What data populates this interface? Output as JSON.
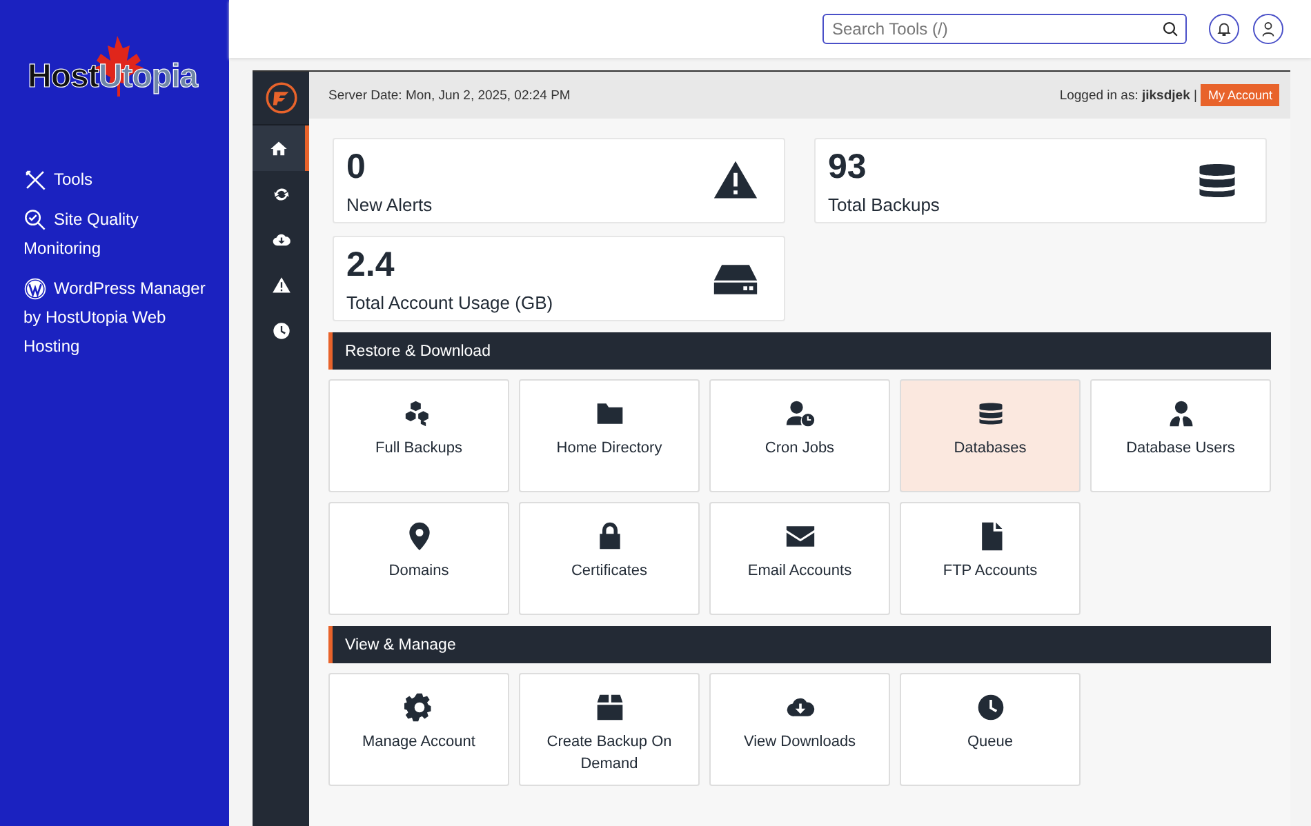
{
  "logo": {
    "dark": "Host",
    "light": "Utopia"
  },
  "sidebar": {
    "items": [
      {
        "label": "Tools"
      },
      {
        "label": "Site Quality Monitoring"
      },
      {
        "label": "WordPress Manager by HostUtopia Web Hosting"
      }
    ]
  },
  "search": {
    "placeholder": "Search Tools (/)"
  },
  "rail": [
    {
      "selected": true
    },
    {
      "selected": false
    },
    {
      "selected": false
    },
    {
      "selected": false
    },
    {
      "selected": false
    }
  ],
  "header": {
    "server_date": "Server Date: Mon, Jun 2, 2025, 02:24 PM",
    "logged_in_label": "Logged in as:",
    "user": "jiksdjek",
    "separator": "|",
    "account_button": "My Account"
  },
  "stats": [
    {
      "value": "0",
      "label": "New Alerts"
    },
    {
      "value": "93",
      "label": "Total Backups"
    },
    {
      "value": "2.4",
      "label": "Total Account Usage (GB)"
    }
  ],
  "sections": [
    {
      "title": "Restore & Download",
      "tiles": [
        {
          "label": "Full Backups",
          "selected": false
        },
        {
          "label": "Home Directory",
          "selected": false
        },
        {
          "label": "Cron Jobs",
          "selected": false
        },
        {
          "label": "Databases",
          "selected": true
        },
        {
          "label": "Database Users",
          "selected": false
        },
        {
          "label": "Domains",
          "selected": false
        },
        {
          "label": "Certificates",
          "selected": false
        },
        {
          "label": "Email Accounts",
          "selected": false
        },
        {
          "label": "FTP Accounts",
          "selected": false
        }
      ]
    },
    {
      "title": "View & Manage",
      "tiles": [
        {
          "label": "Manage Account",
          "selected": false
        },
        {
          "label": "Create Backup On Demand",
          "selected": false
        },
        {
          "label": "View Downloads",
          "selected": false
        },
        {
          "label": "Queue",
          "selected": false
        }
      ]
    }
  ]
}
